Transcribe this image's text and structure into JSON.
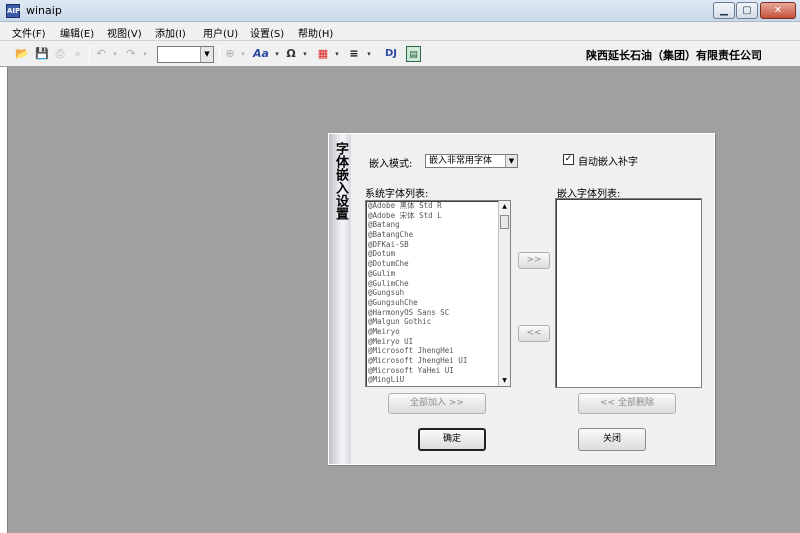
{
  "window": {
    "title": "winaip",
    "icon_label": "AIP",
    "controls": {
      "minimize": "▁",
      "maximize": "▢",
      "close": "✕"
    }
  },
  "menu": [
    "文件(F)",
    "编辑(E)",
    "视图(V)",
    "添加(I)",
    "用户(U)",
    "设置(S)",
    "帮助(H)"
  ],
  "toolbar": {
    "company": "陕西延长石油（集团）有限责任公司",
    "font_icon_label": "Aa",
    "dj_label": "DJ",
    "zoom_value": ""
  },
  "dialog": {
    "side_title": "字体嵌入设置",
    "mode_label": "嵌入模式:",
    "mode_value": "嵌入非常用字体",
    "auto_embed_label": "自动嵌入补字",
    "auto_embed_checked": true,
    "system_fonts_label": "系统字体列表:",
    "embedded_fonts_label": "嵌入字体列表:",
    "system_fonts": [
      "@Adobe 黑体 Std R",
      "@Adobe 宋体 Std L",
      "@Batang",
      "@BatangChe",
      "@DFKai-SB",
      "@Dotum",
      "@DotumChe",
      "@Gulim",
      "@GulimChe",
      "@Gungsuh",
      "@GungsuhChe",
      "@HarmonyOS Sans SC",
      "@Malgun Gothic",
      "@Meiryo",
      "@Meiryo UI",
      "@Microsoft JhengHei",
      "@Microsoft JhengHei UI",
      "@Microsoft YaHei UI",
      "@MingLiU"
    ],
    "embedded_fonts": [],
    "add_arrow": ">>",
    "remove_arrow": "<<",
    "add_all": "全部加入 >>",
    "remove_all": "<< 全部删除",
    "ok": "确定",
    "close": "关闭"
  }
}
